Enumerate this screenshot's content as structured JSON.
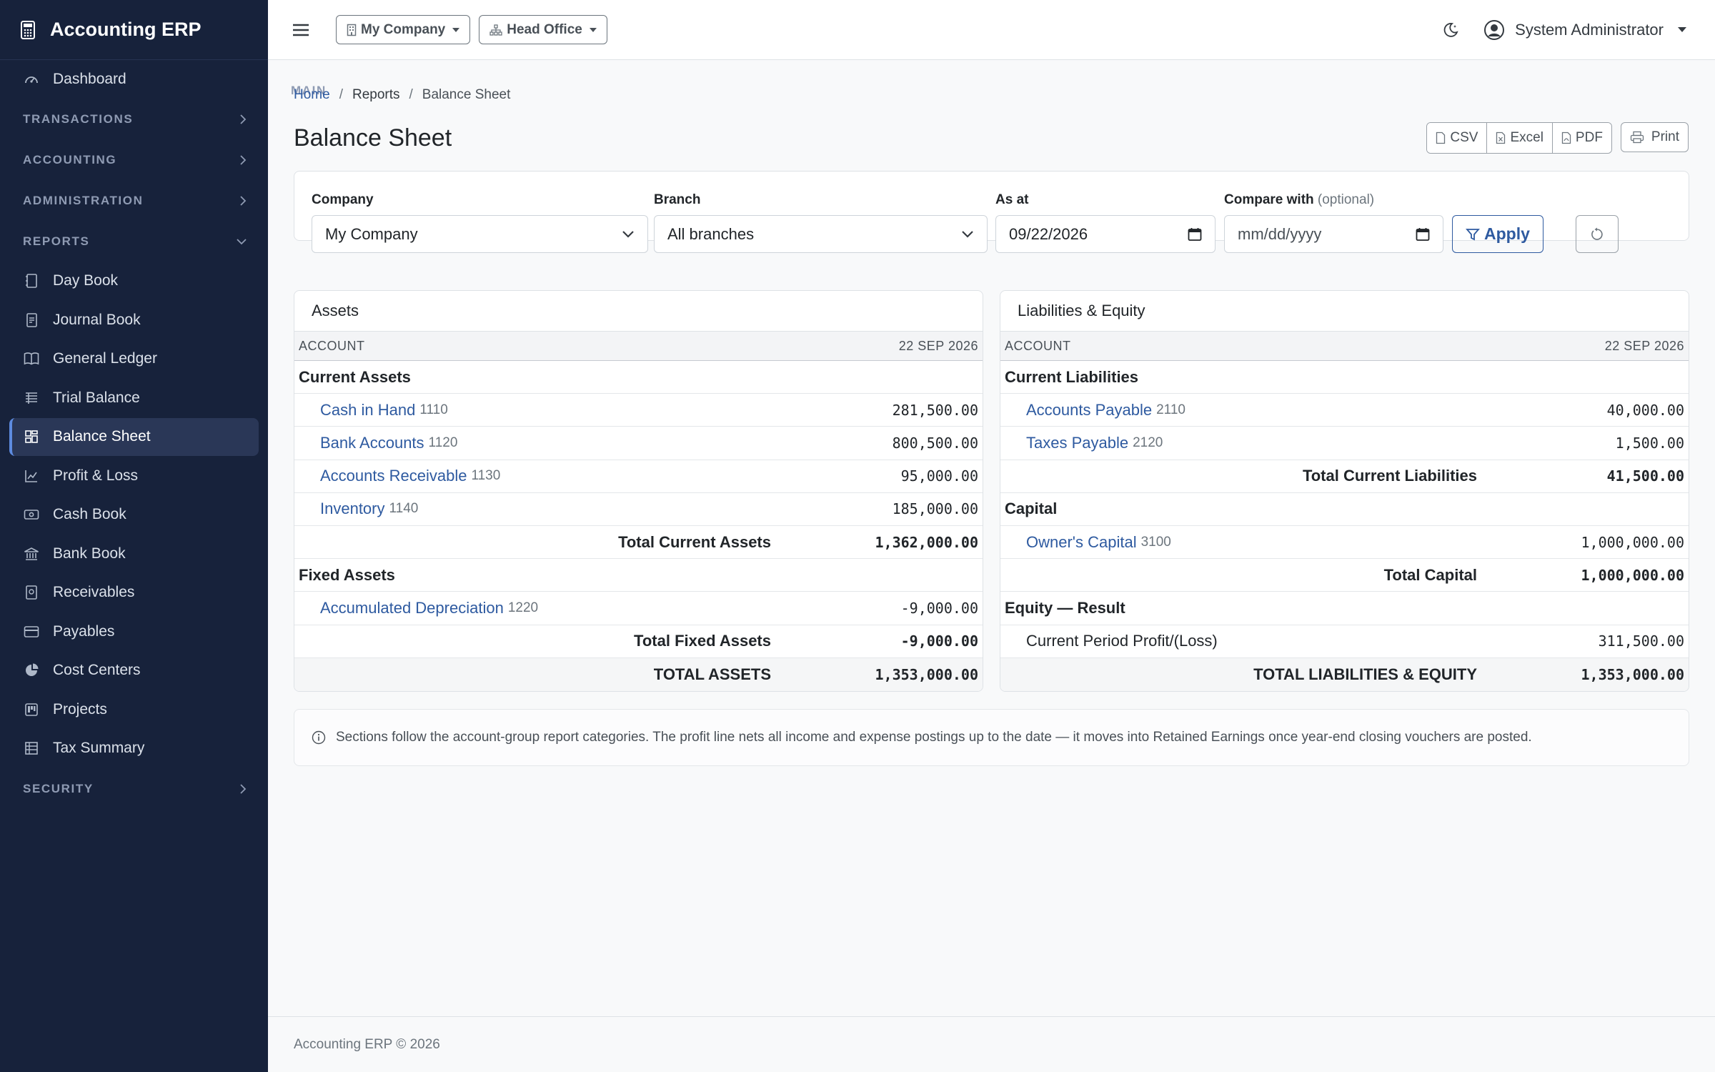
{
  "app": {
    "title": "Accounting ERP",
    "icon": "calculator-icon"
  },
  "sidebar": {
    "main_label": "MAIN",
    "dashboard": "Dashboard",
    "sections": {
      "transactions": "TRANSACTIONS",
      "accounting": "ACCOUNTING",
      "administration": "ADMINISTRATION",
      "reports": "REPORTS",
      "security": "SECURITY"
    },
    "reports_items": [
      {
        "label": "Day Book",
        "icon": "journal-icon"
      },
      {
        "label": "Journal Book",
        "icon": "journal-text-icon"
      },
      {
        "label": "General Ledger",
        "icon": "book-icon"
      },
      {
        "label": "Trial Balance",
        "icon": "list-columns-icon"
      },
      {
        "label": "Balance Sheet",
        "icon": "grid-icon",
        "active": true
      },
      {
        "label": "Profit & Loss",
        "icon": "chart-line-icon"
      },
      {
        "label": "Cash Book",
        "icon": "cash-icon"
      },
      {
        "label": "Bank Book",
        "icon": "bank-icon"
      },
      {
        "label": "Receivables",
        "icon": "receipt-icon"
      },
      {
        "label": "Payables",
        "icon": "credit-card-icon"
      },
      {
        "label": "Cost Centers",
        "icon": "pie-chart-icon"
      },
      {
        "label": "Projects",
        "icon": "kanban-icon"
      },
      {
        "label": "Tax Summary",
        "icon": "tax-table-icon"
      }
    ]
  },
  "topbar": {
    "company": "My Company",
    "branch": "Head Office",
    "user": "System Administrator"
  },
  "breadcrumb": {
    "home": "Home",
    "reports": "Reports",
    "current": "Balance Sheet"
  },
  "page": {
    "title": "Balance Sheet"
  },
  "actions": {
    "csv": "CSV",
    "excel": "Excel",
    "pdf": "PDF",
    "print": "Print"
  },
  "filters": {
    "company_label": "Company",
    "company_value": "My Company",
    "branch_label": "Branch",
    "branch_value": "All branches",
    "asat_label": "As at",
    "asat_value": "09/22/2026",
    "compare_label": "Compare with",
    "compare_optional": "(optional)",
    "compare_placeholder": "mm/dd/yyyy",
    "apply": "Apply"
  },
  "assets": {
    "title": "Assets",
    "col_account": "ACCOUNT",
    "col_date": "22 SEP 2026",
    "current_group": "Current Assets",
    "current_rows": [
      {
        "name": "Cash in Hand",
        "code": "1110",
        "amount": "281,500.00"
      },
      {
        "name": "Bank Accounts",
        "code": "1120",
        "amount": "800,500.00"
      },
      {
        "name": "Accounts Receivable",
        "code": "1130",
        "amount": "95,000.00"
      },
      {
        "name": "Inventory",
        "code": "1140",
        "amount": "185,000.00"
      }
    ],
    "current_total_label": "Total Current Assets",
    "current_total": "1,362,000.00",
    "fixed_group": "Fixed Assets",
    "fixed_rows": [
      {
        "name": "Accumulated Depreciation",
        "code": "1220",
        "amount": "-9,000.00"
      }
    ],
    "fixed_total_label": "Total Fixed Assets",
    "fixed_total": "-9,000.00",
    "grand_label": "TOTAL ASSETS",
    "grand_total": "1,353,000.00"
  },
  "liabilities": {
    "title": "Liabilities & Equity",
    "col_account": "ACCOUNT",
    "col_date": "22 SEP 2026",
    "current_group": "Current Liabilities",
    "current_rows": [
      {
        "name": "Accounts Payable",
        "code": "2110",
        "amount": "40,000.00"
      },
      {
        "name": "Taxes Payable",
        "code": "2120",
        "amount": "1,500.00"
      }
    ],
    "current_total_label": "Total Current Liabilities",
    "current_total": "41,500.00",
    "capital_group": "Capital",
    "capital_rows": [
      {
        "name": "Owner's Capital",
        "code": "3100",
        "amount": "1,000,000.00"
      }
    ],
    "capital_total_label": "Total Capital",
    "capital_total": "1,000,000.00",
    "equity_group": "Equity — Result",
    "profit_label": "Current Period Profit/(Loss)",
    "profit_amount": "311,500.00",
    "grand_label": "TOTAL LIABILITIES & EQUITY",
    "grand_total": "1,353,000.00"
  },
  "info": "Sections follow the account-group report categories. The profit line nets all income and expense postings up to the date — it moves into Retained Earnings once year-end closing vouchers are posted.",
  "footer": "Accounting ERP © 2026"
}
